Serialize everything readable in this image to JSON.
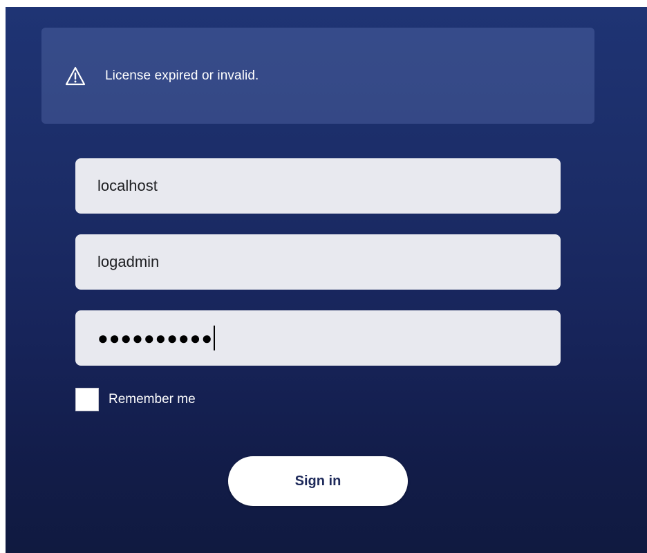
{
  "alert": {
    "icon": "warning-triangle-icon",
    "message": "License expired or invalid."
  },
  "form": {
    "server_value": "localhost",
    "username_value": "logadmin",
    "password_masked": "●●●●●●●●●●",
    "remember_label": "Remember me",
    "remember_checked": false,
    "signin_label": "Sign in"
  },
  "colors": {
    "background_top": "#1f3474",
    "background_bottom": "#101a40",
    "field_bg": "#e8e9ef",
    "button_text": "#1e2a5a"
  }
}
